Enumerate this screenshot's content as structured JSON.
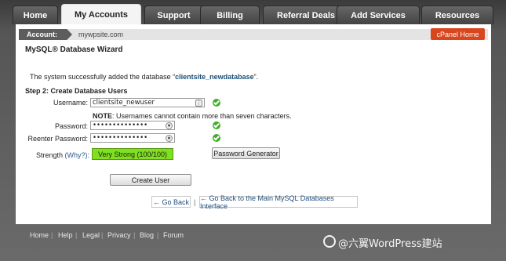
{
  "tabs": [
    "Home",
    "My Accounts",
    "Support",
    "Billing",
    "Referral Deals",
    "Add Services",
    "Resources"
  ],
  "active_tab": "My Accounts",
  "account_bar": {
    "label": "Account:",
    "domain": "mywpsite.com",
    "cpanel_home": "cPanel Home"
  },
  "page_title": "MySQL® Database Wizard",
  "success": {
    "prefix": "The system successfully added the database “",
    "database": "clientsite_newdatabase",
    "suffix": "”."
  },
  "step_title": "Step 2: Create Database Users",
  "form": {
    "username_label": "Username:",
    "username_value": "clientsite_newuser",
    "note_bold": "NOTE",
    "note_text": ": Usernames cannot contain more than seven characters.",
    "password_label": "Password:",
    "password_value": "••••••••••••••",
    "reenter_label": "Reenter Password:",
    "reenter_value": "••••••••••••••",
    "strength_label": "Strength",
    "why_link": "(Why?):",
    "strength_value": "Very Strong (100/100)",
    "password_generator": "Password Generator",
    "create_user": "Create User"
  },
  "nav": {
    "go_back": "← Go Back",
    "separator": "|",
    "go_back_main": "← Go Back to the Main MySQL Databases Interface"
  },
  "footer": [
    "Home",
    "Help",
    "Legal",
    "Privacy",
    "Blog",
    "Forum"
  ],
  "watermark": "@六翼WordPress建站",
  "icons": {
    "check": "check-circle-icon",
    "field_button": "field-menu-icon",
    "key": "key-icon"
  },
  "colors": {
    "cpanel_home": "#d9451c",
    "strength_bar": "#7ee01f",
    "check": "#3fae2a",
    "database_name": "#1a4f77"
  }
}
